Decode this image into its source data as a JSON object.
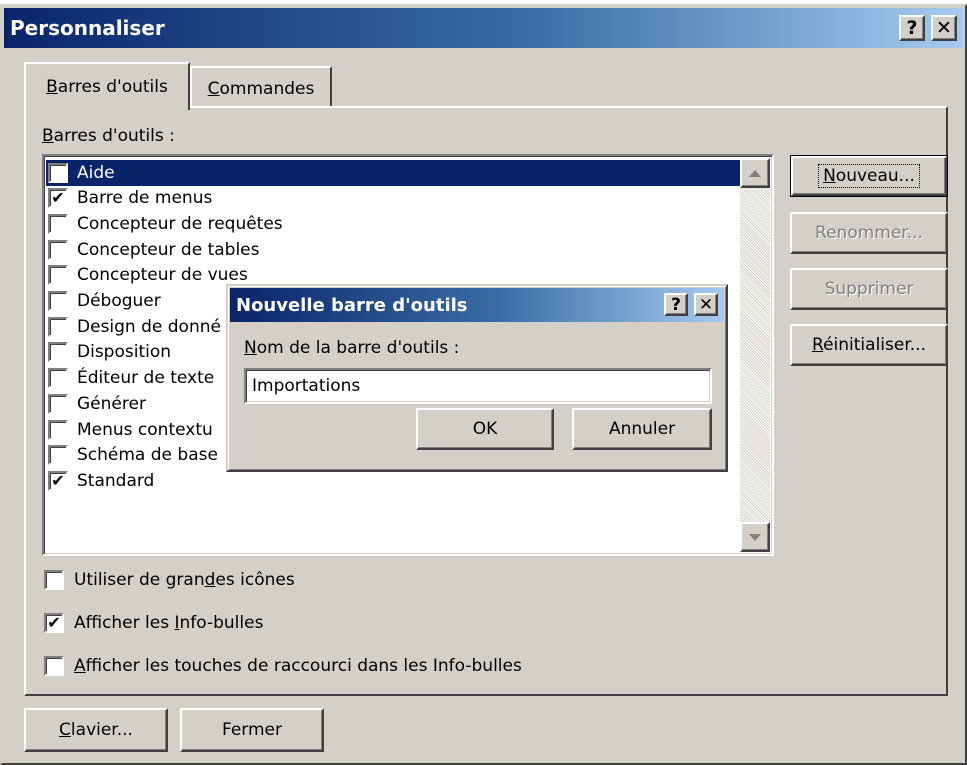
{
  "window": {
    "title": "Personnaliser",
    "help_button": "?",
    "close_button": "✕"
  },
  "tabs": [
    {
      "label": "Barres d'outils",
      "underline": "B",
      "rest": "arres d'outils",
      "active": true
    },
    {
      "label": "Commandes",
      "underline": "C",
      "rest": "ommandes",
      "active": false
    }
  ],
  "toolbars_section": {
    "label_u": "B",
    "label_rest": "arres d'outils :",
    "items": [
      {
        "label": "Aide",
        "checked": false,
        "selected": true
      },
      {
        "label": "Barre de menus",
        "checked": true
      },
      {
        "label": "Concepteur de requêtes",
        "checked": false
      },
      {
        "label": "Concepteur de tables",
        "checked": false
      },
      {
        "label": "Concepteur de vues",
        "checked": false
      },
      {
        "label": "Déboguer",
        "checked": false
      },
      {
        "label": "Design de donné",
        "checked": false
      },
      {
        "label": "Disposition",
        "checked": false
      },
      {
        "label": "Éditeur de texte",
        "checked": false
      },
      {
        "label": "Générer",
        "checked": false
      },
      {
        "label": "Menus contextu",
        "checked": false
      },
      {
        "label": "Schéma de base",
        "checked": false
      },
      {
        "label": "Standard",
        "checked": true
      }
    ]
  },
  "side_buttons": {
    "new_u": "N",
    "new_rest": "ouveau...",
    "rename": "Renommer...",
    "delete": "Supprimer",
    "reset_u": "R",
    "reset_rest": "éinitialiser..."
  },
  "options": [
    {
      "checked": false,
      "pre": "Utiliser de gran",
      "u": "d",
      "post": "es icônes"
    },
    {
      "checked": true,
      "pre": "Afficher les ",
      "u": "I",
      "post": "nfo-bulles"
    },
    {
      "checked": false,
      "pre": "",
      "u": "A",
      "post": "fficher les touches de raccourci dans les Info-bulles"
    }
  ],
  "footer": {
    "keyboard_u": "C",
    "keyboard_rest": "lavier...",
    "close": "Fermer"
  },
  "new_toolbar_dialog": {
    "title": "Nouvelle barre d'outils",
    "help_button": "?",
    "close_button": "✕",
    "field_label_u": "N",
    "field_label_rest": "om de la barre d'outils :",
    "field_value": "Importations",
    "ok": "OK",
    "cancel": "Annuler"
  },
  "colors": {
    "face": "#d4d0c8",
    "title_active_start": "#0a246a",
    "title_active_end": "#a6caf0",
    "selection": "#0a246a",
    "disabled_text": "#808080"
  }
}
